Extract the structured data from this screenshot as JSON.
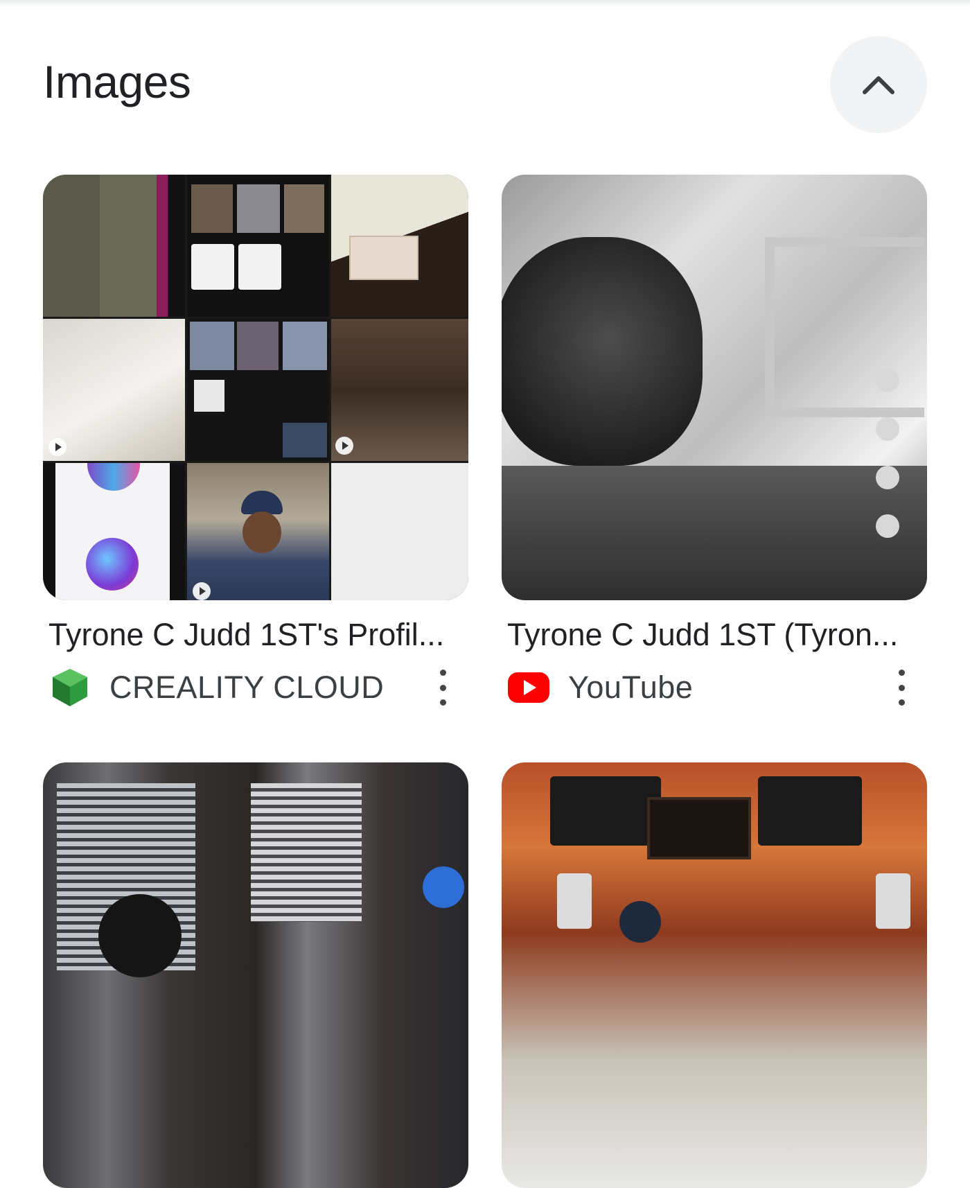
{
  "section": {
    "title": "Images",
    "collapse_icon": "chevron-up-icon"
  },
  "results": [
    {
      "caption": "Tyrone C Judd 1ST's Profil...",
      "source": "CREALITY CLOUD",
      "source_icon": "creality-cloud-logo-icon",
      "source_color": "#2e9c3e"
    },
    {
      "caption": "Tyrone C Judd 1ST (Tyron...",
      "source": "YouTube",
      "source_icon": "youtube-logo-icon",
      "source_color": "#ff0000"
    },
    {
      "caption": "",
      "source": ""
    },
    {
      "caption": "",
      "source": ""
    }
  ]
}
